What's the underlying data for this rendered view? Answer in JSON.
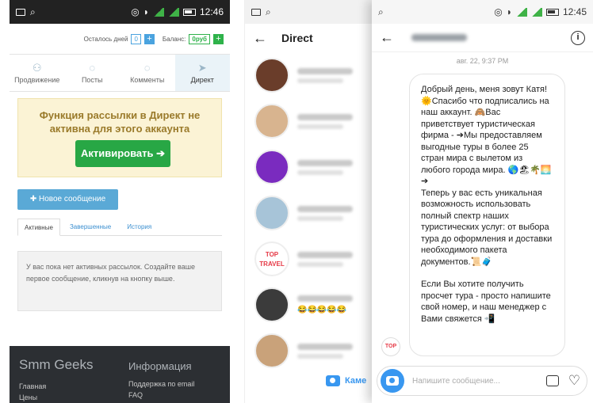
{
  "panel1": {
    "status_time": "12:46",
    "balance": {
      "days_label": "Осталось дней",
      "days_value": "0",
      "plus": "+",
      "balance_label": "Баланс:",
      "balance_value": "0руб"
    },
    "tabs": [
      {
        "label": "Продвижение",
        "icon": "users-icon"
      },
      {
        "label": "Посты",
        "icon": "chat-bubble-icon"
      },
      {
        "label": "Комменты",
        "icon": "comment-icon"
      },
      {
        "label": "Директ",
        "icon": "paper-plane-icon"
      }
    ],
    "alert_text": "Функция рассылки в Директ не активна для этого аккаунта",
    "activate_button": "Активировать ➔",
    "new_message_button": "✚ Новое сообщение",
    "subtabs": [
      "Активные",
      "Завершенные",
      "История"
    ],
    "empty_text": "У вас пока нет активных рассылок. Создайте ваше первое сообщение, кликнув на кнопку выше.",
    "footer": {
      "brand": "Smm Geeks",
      "info_heading": "Информация",
      "links": [
        "Главная",
        "Цены",
        "Поддержка по email",
        "FAQ"
      ]
    },
    "colors": {
      "accent": "#28a745",
      "alert_bg": "#fbf3d5",
      "footer_bg": "#2c2f33"
    }
  },
  "panel2": {
    "header_title": "Direct",
    "camera_label": "Каме",
    "threads": [
      {
        "avatar_color": "#6a3d2a"
      },
      {
        "avatar_color": "#d8b48f"
      },
      {
        "avatar_color": "#7a2bbf"
      },
      {
        "avatar_color": "#a7c4d8"
      },
      {
        "avatar_color": "#ffffff",
        "avatar_text": "TOP TRAVEL"
      },
      {
        "avatar_color": "#3b3b3b",
        "emojis": "😂😂😂😂😂"
      },
      {
        "avatar_color": "#c9a27a"
      }
    ]
  },
  "panel3": {
    "status_time": "12:45",
    "info_icon": "i",
    "date": "авг. 22, 9:37 PM",
    "message_paragraphs": [
      "Добрый день, меня зовут Катя! 🌞Спасибо что подписались на наш аккаунт. 🙈Вас приветствует туристическая фирма - ➔Мы предоставляем выгодные туры в более 25 стран мира с вылетом из любого города мира. 🌎🏖🌴🌅➔\nТеперь у вас есть уникальная возможность использовать полный спектр наших туристических услуг: от выбора тура до оформления и доставки необходимого пакета документов.📜🧳",
      "Если Вы хотите получить просчет тура - просто напишите свой номер, и наш менеджер с Вами свяжется 📲"
    ],
    "sender_avatar_text": "TOP",
    "composer_placeholder": "Напишите сообщение...",
    "heart_icon": "♡"
  }
}
